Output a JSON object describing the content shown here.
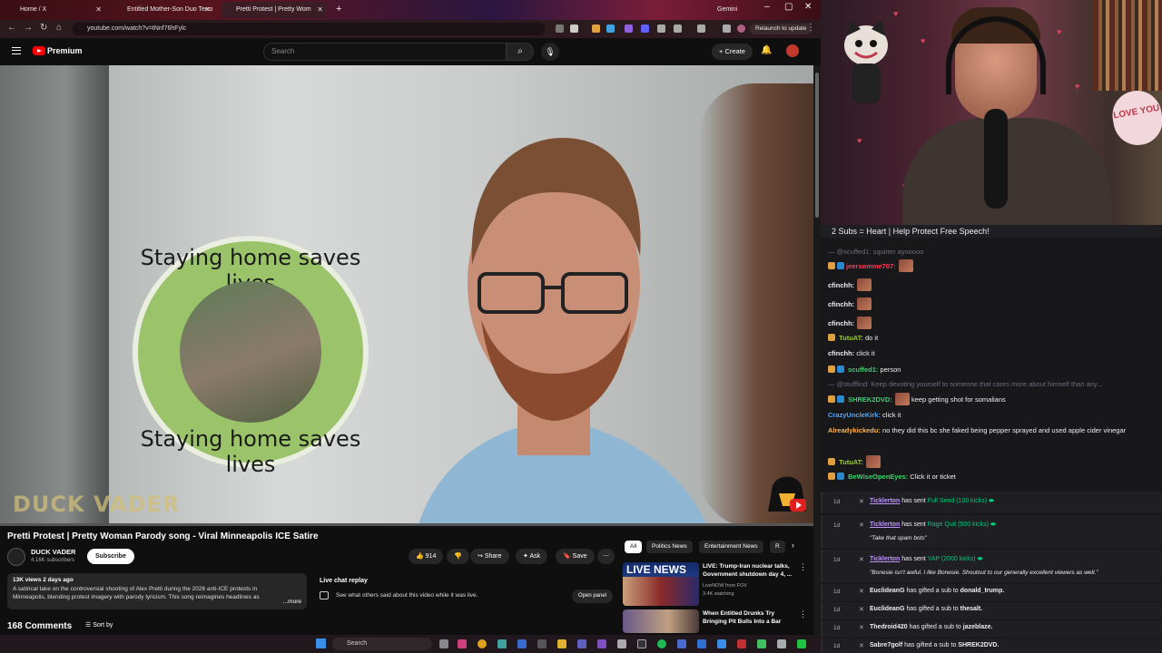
{
  "browser": {
    "tabs": [
      {
        "label": "Home / X",
        "active": false
      },
      {
        "label": "Entitled Mother-Son Duo Terro",
        "active": false
      },
      {
        "label": "Pretti Protest | Pretty Wom",
        "active": true
      }
    ],
    "new_tab": "+",
    "gemini": "Gemini",
    "url": "youtube.com/watch?v=tNnf76hFylc",
    "relaunch": "Relaunch to update"
  },
  "youtube": {
    "brand": "Premium",
    "search_placeholder": "Search",
    "create_label": "Create",
    "video": {
      "sticker_top": "Staying home saves lives",
      "sticker_bottom": "Staying home saves lives",
      "watermark": "DUCK VADER",
      "progress": 0.0
    },
    "title": "Pretti Protest | Pretty Woman Parody song - Viral Minneapolis ICE Satire",
    "channel": {
      "name": "DUCK VADER",
      "subs": "4.16K subscribers",
      "subscribe": "Subscribe"
    },
    "actions": {
      "likes": "914",
      "share": "Share",
      "ask": "Ask",
      "save": "Save"
    },
    "description": {
      "meta": "13K views  2 days ago",
      "body": "A satirical take on the controversial shooting of Alex Pretti during the 2026 anti-ICE protests in Minneapolis, blending protest imagery with parody lyricism. This song reimagines headlines as",
      "more": "...more"
    },
    "live_chat": {
      "heading": "Live chat replay",
      "text": "See what others said about this video while it was live.",
      "open": "Open panel"
    },
    "comments": {
      "count": "168 Comments",
      "sort": "Sort by"
    },
    "chips": [
      "All",
      "Politics News",
      "Entertainment News",
      "R"
    ],
    "recs": [
      {
        "thumb_text": "LIVE NEWS",
        "title": "LIVE: Trump-Iran nuclear talks, Government shutdown day 4, ...",
        "channel": "LiveNOW from FOX",
        "meta": "3.4K watching"
      },
      {
        "thumb_text": "",
        "title": "When Entitled Drunks Try Bringing Pit Bulls Into a Bar",
        "channel": "",
        "meta": ""
      }
    ]
  },
  "taskbar": {
    "search": "Search"
  },
  "webcam": {
    "pillow": "LOVE YOU"
  },
  "chat": {
    "banner": "2 Subs = Heart | Help Protect Free Speech!",
    "messages": [
      {
        "user": "",
        "text": "— @scuffed1: squirter ayooooo",
        "faded": true
      },
      {
        "user": "jeersomme707:",
        "text": "",
        "color": "#ff3b5c",
        "emote": true
      },
      {
        "user": "cfinchh:",
        "text": "",
        "color": "#efeff1",
        "emote": true
      },
      {
        "user": "cfinchh:",
        "text": "",
        "color": "#efeff1",
        "emote": true
      },
      {
        "user": "cfinchh:",
        "text": "",
        "color": "#efeff1",
        "emote": true
      },
      {
        "user": "TutuAT:",
        "text": "do it",
        "color": "#9acd32"
      },
      {
        "user": "cfinchh:",
        "text": "click it",
        "color": "#efeff1"
      },
      {
        "user": "scuffed1:",
        "text": "person",
        "color": "#3cd070"
      },
      {
        "user": "",
        "text": "— @stufffind: Keep devoting yourself to someone that cares more about himself than any...",
        "faded": true
      },
      {
        "user": "SHREK2DVD:",
        "text": "keep getting shot for somalians",
        "color": "#3cd070",
        "emote": true
      },
      {
        "user": "CrazyUncleKirk:",
        "text": "click it",
        "color": "#4aa8ff"
      },
      {
        "user": "Alreadykickedu:",
        "text": "no they did this bc she faked being pepper sprayed and used apple cider vinegar",
        "color": "#ffb347"
      },
      {
        "user": "TutuAT:",
        "text": "",
        "color": "#9acd32",
        "emote": true
      },
      {
        "user": "BeWiseOpenEyes:",
        "text": "Click it or ticket",
        "color": "#3cd070"
      }
    ],
    "events": [
      {
        "ago": "1d",
        "user": "Ticklerton",
        "mid": "has sent",
        "item": "Full Send (100 kicks)",
        "quote": ""
      },
      {
        "ago": "1d",
        "user": "Ticklerton",
        "mid": "has sent",
        "item": "Rage Quit (500 kicks)",
        "quote": "\"Take that spam bots\""
      },
      {
        "ago": "1d",
        "user": "Ticklerton",
        "mid": "has sent",
        "item": "YAP (2000 kicks)",
        "quote": "\"Bonesie isn't awful. I like Bonesie. Shoutout to our generally excellent viewers as well.\""
      },
      {
        "ago": "1d",
        "user": "EuclideanG",
        "mid": "has gifted a sub to",
        "item": "donald_trump.",
        "quote": ""
      },
      {
        "ago": "1d",
        "user": "EuclideanG",
        "mid": "has gifted a sub to",
        "item": "thesalt.",
        "quote": ""
      },
      {
        "ago": "1d",
        "user": "Thedroid420",
        "mid": "has gifted a sub to",
        "item": "jazeblaze.",
        "quote": ""
      },
      {
        "ago": "1d",
        "user": "Sabre7golf",
        "mid": "has gifted a sub to",
        "item": "SHREK2DVD.",
        "quote": ""
      }
    ]
  }
}
